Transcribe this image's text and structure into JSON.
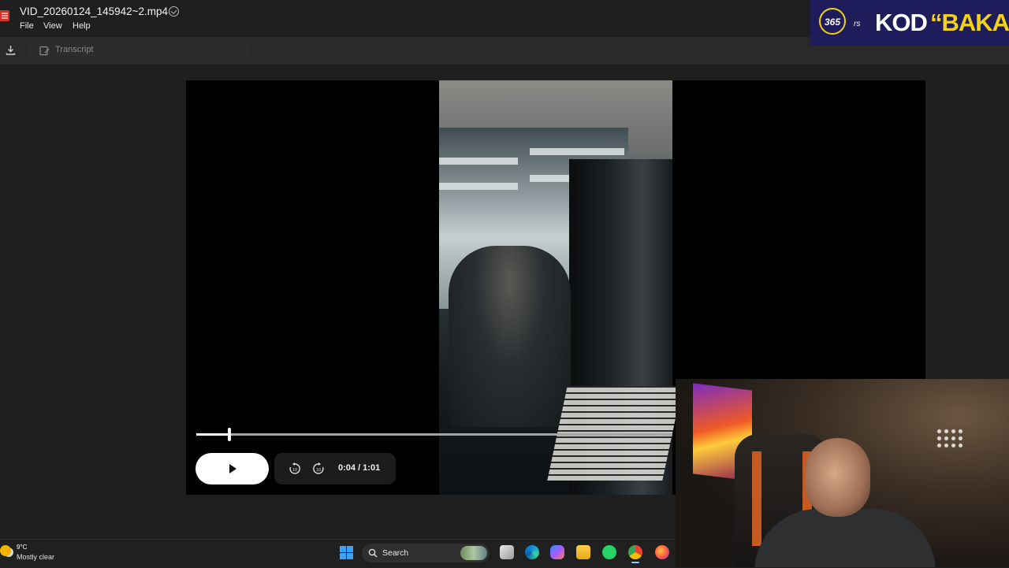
{
  "window": {
    "title": "VID_20260124_145942~2.mp4",
    "menu": [
      "File",
      "View",
      "Help"
    ]
  },
  "toolbar": {
    "transcript_label": "Transcript"
  },
  "player": {
    "time_display": "0:04 / 1:01",
    "progress_fraction": 0.066,
    "skip_back_seconds": "10",
    "skip_forward_seconds": "10"
  },
  "overlay": {
    "brand_number": "365",
    "brand_suffix": "rs",
    "headline_white": "KOD",
    "headline_yellow": "“BAKA”",
    "colors": {
      "brand_bg": "#1e1c5a",
      "brand_accent": "#f2d21b"
    }
  },
  "taskbar": {
    "weather_temp": "9°C",
    "weather_desc": "Mostly clear",
    "search_placeholder": "Search",
    "apps": [
      "start-icon",
      "task-view-icon",
      "edge-icon",
      "copilot-icon",
      "file-explorer-icon",
      "whatsapp-icon",
      "chrome-icon",
      "firefox-icon"
    ]
  }
}
